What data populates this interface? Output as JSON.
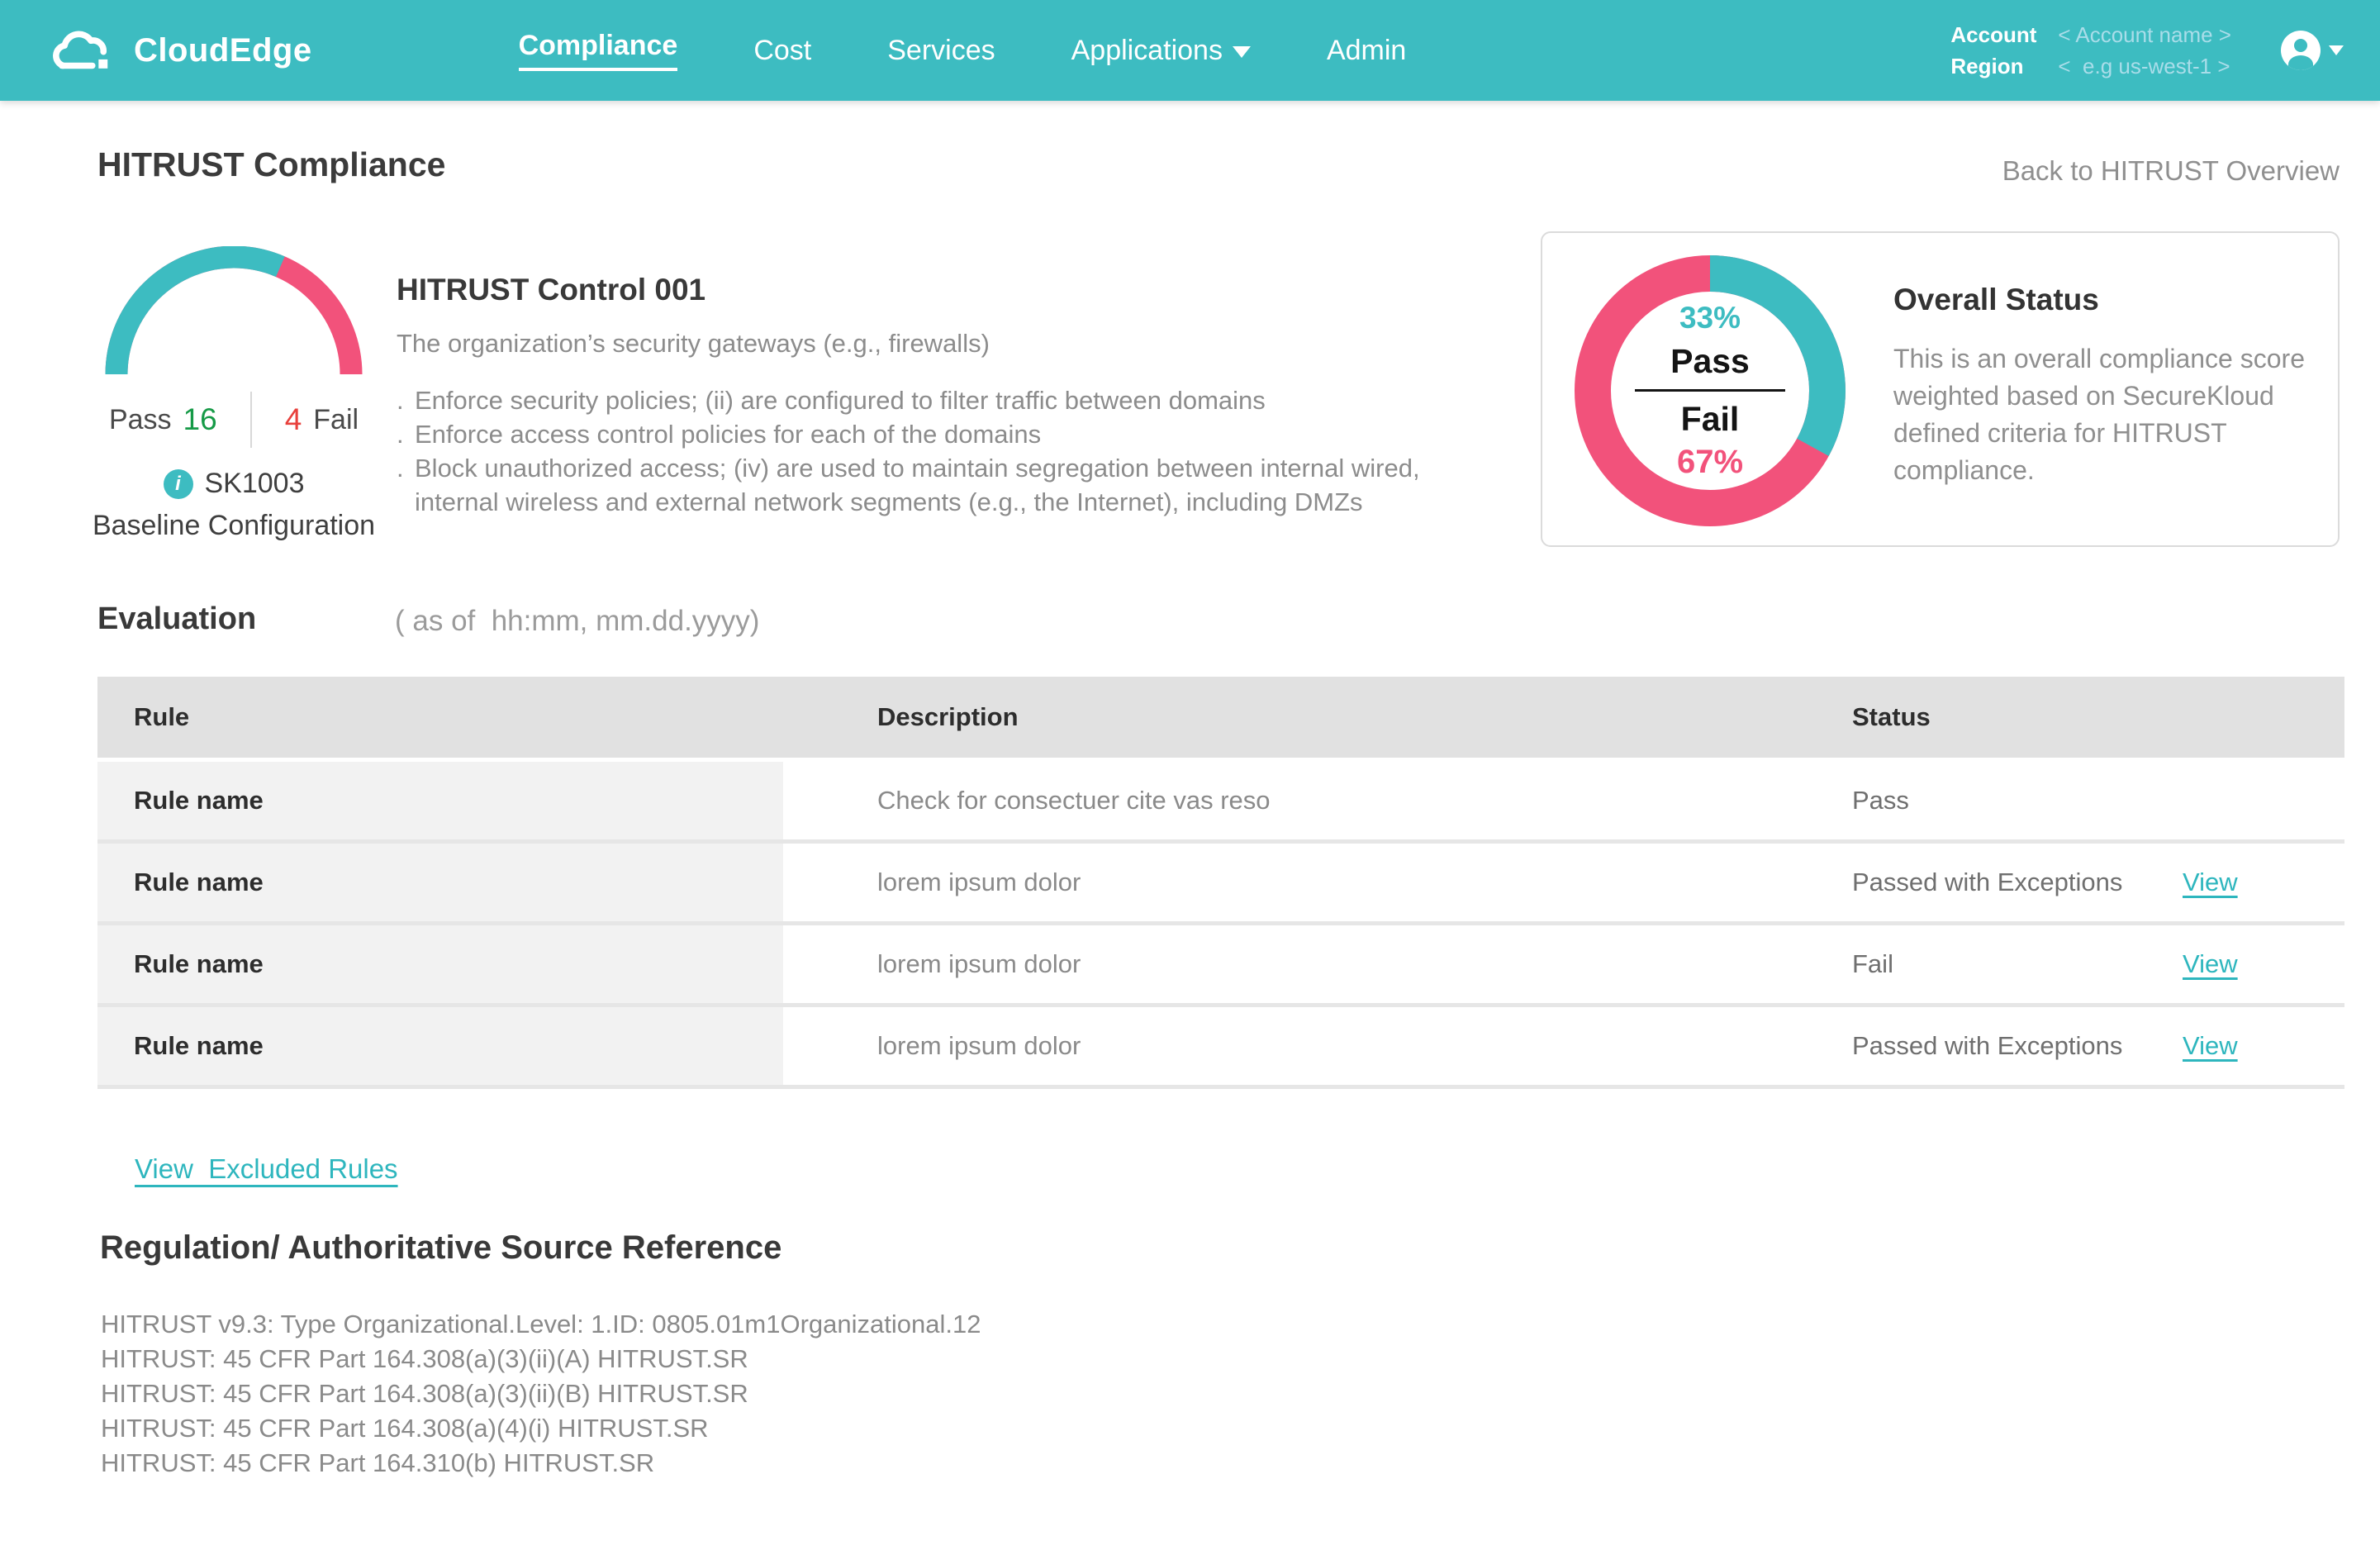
{
  "colors": {
    "teal": "#3dbcc1",
    "pink": "#f2527b",
    "link_teal": "#2eb6be",
    "pass_green": "#169a47",
    "fail_red": "#e8403c"
  },
  "nav": {
    "brand": "CloudEdge",
    "items": [
      {
        "label": "Compliance",
        "active": true,
        "caret": false
      },
      {
        "label": "Cost",
        "active": false,
        "caret": false
      },
      {
        "label": "Services",
        "active": false,
        "caret": false
      },
      {
        "label": "Applications",
        "active": false,
        "caret": true
      },
      {
        "label": "Admin",
        "active": false,
        "caret": false
      }
    ],
    "account_label": "Account",
    "account_value": "< Account name >",
    "region_label": "Region",
    "region_value": "<  e.g us-west-1 >"
  },
  "page": {
    "title": "HITRUST Compliance",
    "back_link": "Back to HITRUST Overview"
  },
  "gauge": {
    "pass_label": "Pass",
    "pass_count": "16",
    "fail_count": "4",
    "fail_label": "Fail",
    "arc_pass_pct": 63,
    "code": "SK1003",
    "info_icon_char": "i",
    "baseline": "Baseline Configuration"
  },
  "control": {
    "title": "HITRUST Control 001",
    "subtitle": "The organization’s security gateways (e.g., firewalls)",
    "bullet_char": ".",
    "bullets": [
      "Enforce security policies; (ii) are configured to filter traffic between domains",
      "Enforce access control policies for each of the domains",
      "Block unauthorized access; (iv) are used to maintain segregation between internal wired,\ninternal wireless and external network segments (e.g., the Internet), including DMZs"
    ]
  },
  "overall": {
    "title": "Overall Status",
    "description": "This is an overall compliance score weighted based on SecureKloud defined criteria for HITRUST compliance.",
    "pass_pct": "33%",
    "pass_value": 33,
    "pass_label": "Pass",
    "fail_label": "Fail",
    "fail_pct": "67%",
    "fail_value": 67
  },
  "evaluation": {
    "title": "Evaluation",
    "as_of": "( as of  hh:mm, mm.dd.yyyy)",
    "columns": [
      "Rule",
      "Description",
      "Status"
    ],
    "view_label": "View",
    "rows": [
      {
        "rule": "Rule name",
        "description": "Check for consectuer cite vas reso",
        "status": "Pass",
        "view": false
      },
      {
        "rule": "Rule name",
        "description": "lorem ipsum dolor",
        "status": "Passed with Exceptions",
        "view": true
      },
      {
        "rule": "Rule name",
        "description": "lorem ipsum dolor",
        "status": "Fail",
        "view": true
      },
      {
        "rule": "Rule name",
        "description": "lorem ipsum dolor",
        "status": "Passed with Exceptions",
        "view": true
      }
    ],
    "excluded_link": "View  Excluded Rules"
  },
  "regulation": {
    "title": "Regulation/ Authoritative Source Reference",
    "lines": [
      "HITRUST v9.3: Type Organizational.Level: 1.ID: 0805.01m1Organizational.12",
      "HITRUST: 45 CFR Part 164.308(a)(3)(ii)(A) HITRUST.SR",
      "HITRUST: 45 CFR Part 164.308(a)(3)(ii)(B) HITRUST.SR",
      "HITRUST: 45 CFR Part 164.308(a)(4)(i) HITRUST.SR",
      "HITRUST: 45 CFR Part 164.310(b) HITRUST.SR"
    ]
  },
  "chart_data": [
    {
      "type": "gauge",
      "title": "Rule results",
      "slices": [
        {
          "label": "Pass",
          "value": 16,
          "color": "#3dbcc1"
        },
        {
          "label": "Fail",
          "value": 4,
          "color": "#f2527b"
        }
      ]
    },
    {
      "type": "pie",
      "title": "Overall Status",
      "slices": [
        {
          "label": "Pass",
          "value": 33,
          "color": "#3dbcc1"
        },
        {
          "label": "Fail",
          "value": 67,
          "color": "#f2527b"
        }
      ]
    }
  ]
}
